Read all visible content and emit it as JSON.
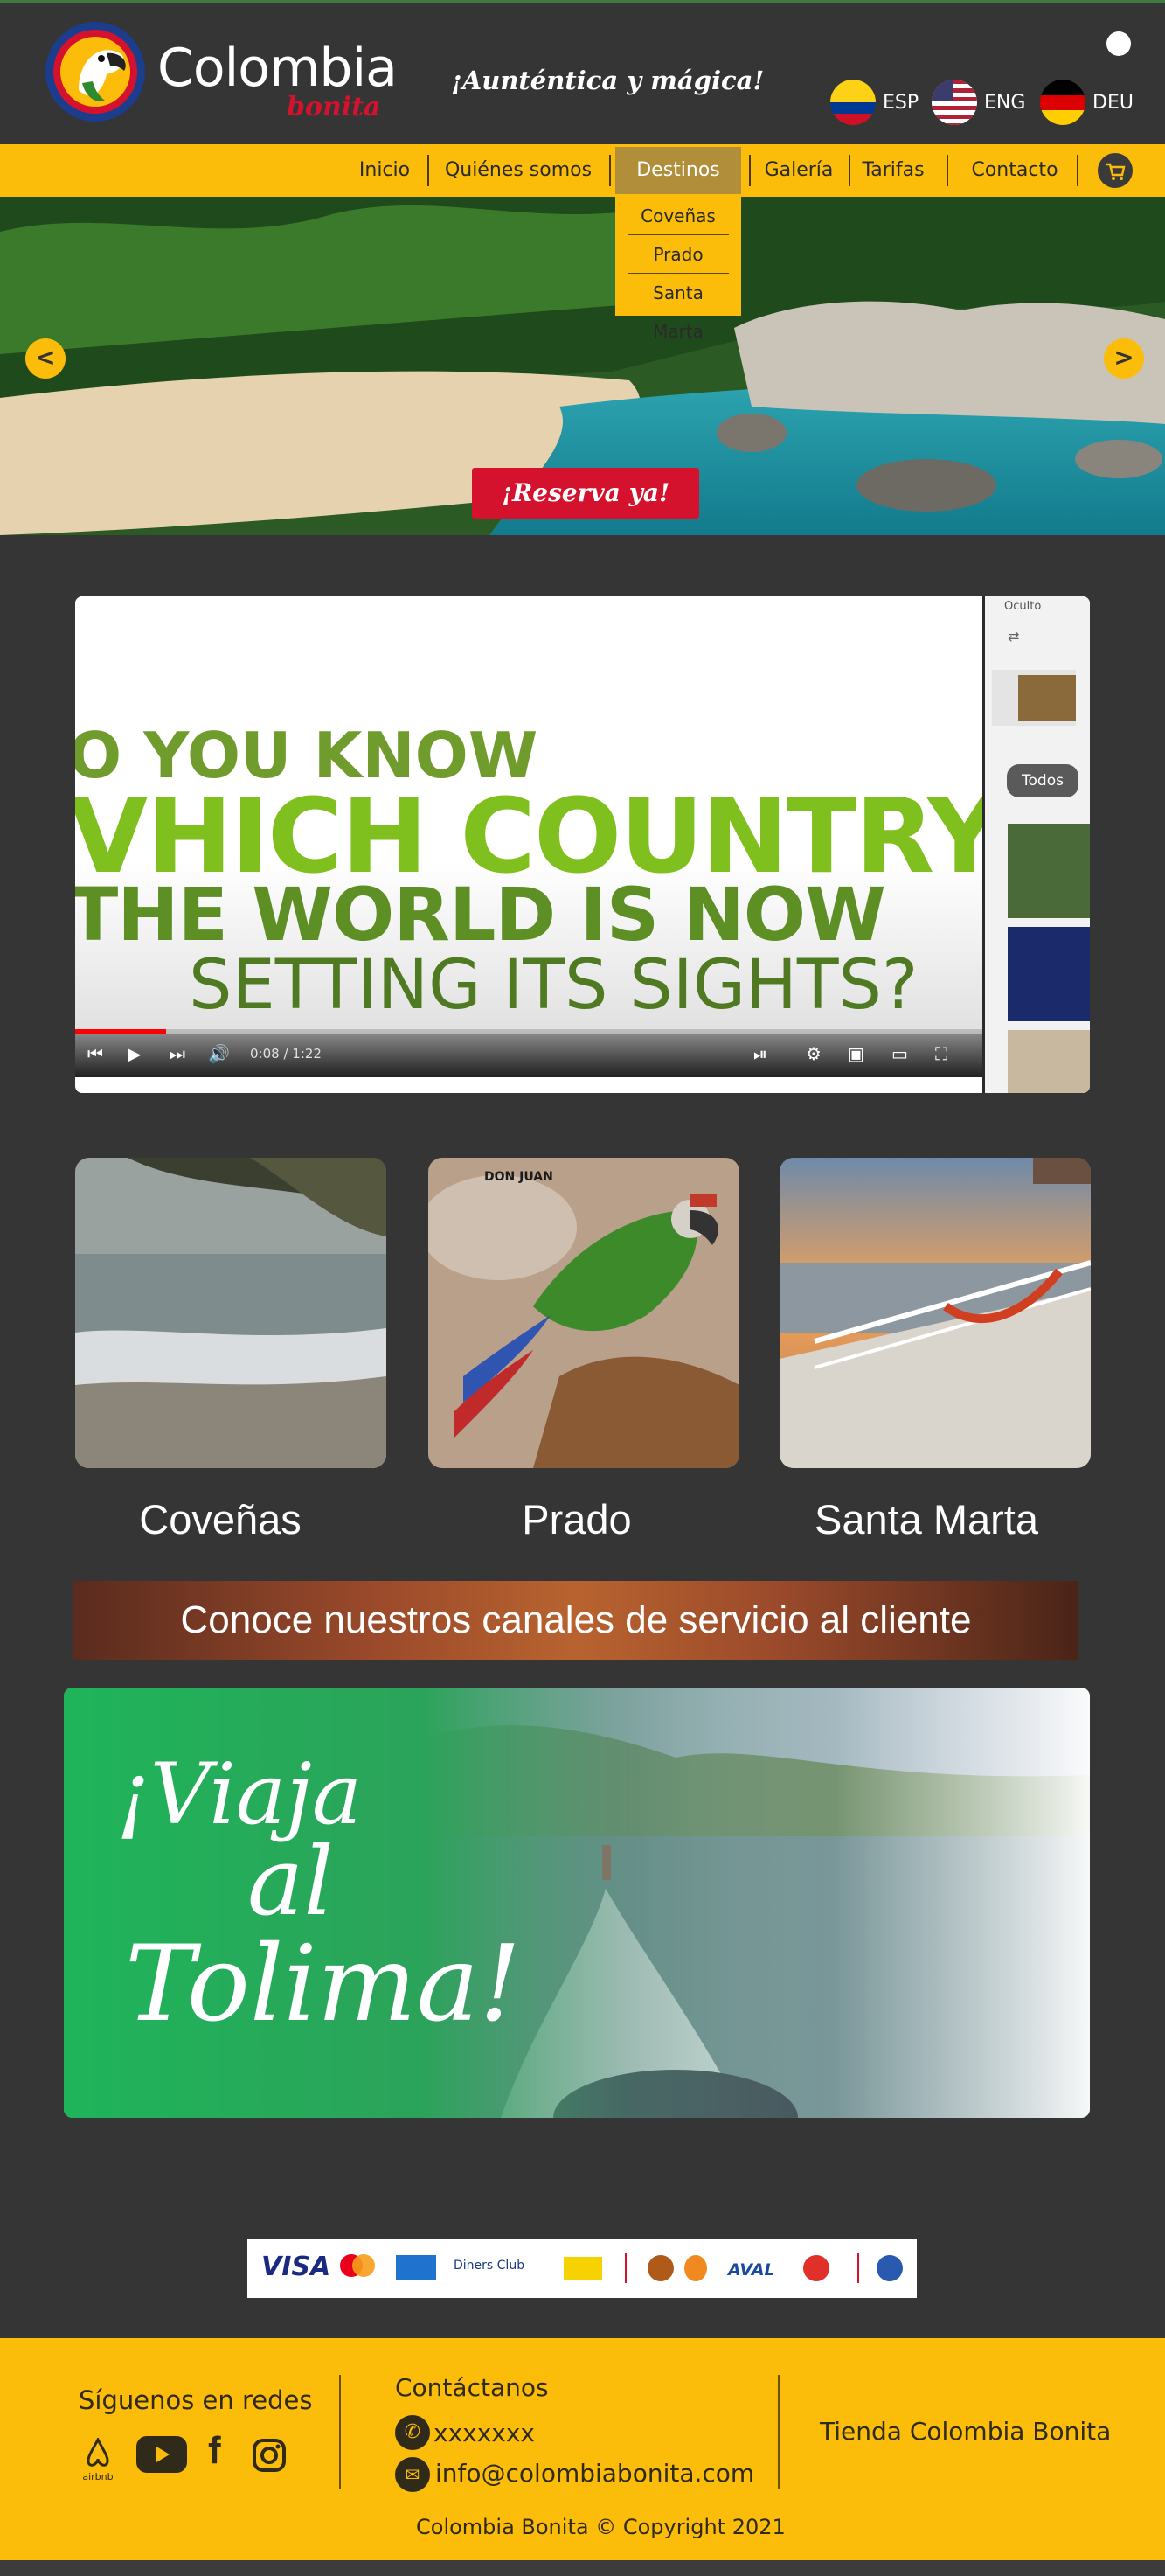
{
  "brand": {
    "name": "Colombia",
    "sub": "bonita",
    "slogan": "¡Aunténtica y mágica!"
  },
  "languages": [
    {
      "code": "ESP",
      "flag": "colombia-flag"
    },
    {
      "code": "ENG",
      "flag": "usa-flag"
    },
    {
      "code": "DEU",
      "flag": "germany-flag"
    }
  ],
  "nav": {
    "items": [
      "Inicio",
      "Quiénes somos",
      "Destinos",
      "Galería",
      "Tarifas",
      "Contacto"
    ],
    "active": "Destinos",
    "dropdown": [
      "Coveñas",
      "Prado",
      "Santa Marta"
    ]
  },
  "hero": {
    "prev": "<",
    "next": ">",
    "cta": "¡Reserva ya!"
  },
  "video": {
    "lines": [
      "O YOU KNOW",
      "VHICH COUNTRY",
      "THE WORLD IS NOW",
      "SETTING ITS SIGHTS?"
    ],
    "time": "0:08 / 1:22",
    "progress": 0.1,
    "side_label": "Oculto",
    "filter": "Todos"
  },
  "destinations": [
    {
      "name": "Coveñas"
    },
    {
      "name": "Prado",
      "caption": "DON JUAN"
    },
    {
      "name": "Santa Marta"
    }
  ],
  "service_banner": "Conoce nuestros canales de servicio al cliente",
  "promo": {
    "line1": "¡Viaja",
    "line2": "al",
    "line3": "Tolima!"
  },
  "payments": [
    "VISA",
    "Diners Club",
    "AVAL"
  ],
  "footer": {
    "social_title": "Síguenos en redes",
    "airbnb": "airbnb",
    "contact_title": "Contáctanos",
    "phone": "xxxxxxx",
    "email": "info@colombiabonita.com",
    "store": "Tienda Colombia Bonita",
    "copyright": "Colombia Bonita © Copyright 2021"
  },
  "colors": {
    "yellow": "#fbbd09",
    "red": "#d5122d",
    "dark": "#353535"
  }
}
